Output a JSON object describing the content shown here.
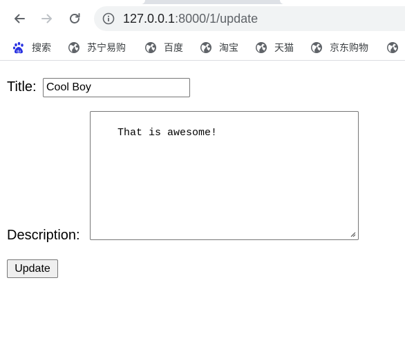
{
  "browser": {
    "url_host": "127.0.0.1",
    "url_rest": ":8000/1/update",
    "bookmarks": [
      {
        "label": "搜索",
        "icon": "baidu-paw-icon"
      },
      {
        "label": "苏宁易购",
        "icon": "globe-icon"
      },
      {
        "label": "百度",
        "icon": "globe-icon"
      },
      {
        "label": "淘宝",
        "icon": "globe-icon"
      },
      {
        "label": "天猫",
        "icon": "globe-icon"
      },
      {
        "label": "京东购物",
        "icon": "globe-icon"
      },
      {
        "label": "",
        "icon": "globe-icon"
      }
    ]
  },
  "form": {
    "title_label": "Title:",
    "title_value": "Cool Boy",
    "description_label": "Description:",
    "description_value": "That is awesome!",
    "submit_label": "Update"
  },
  "colors": {
    "chrome_bg": "#dee1e6",
    "omnibox_bg": "#f1f3f4",
    "icon_gray": "#5f6368",
    "baidu_blue": "#2932e1"
  }
}
